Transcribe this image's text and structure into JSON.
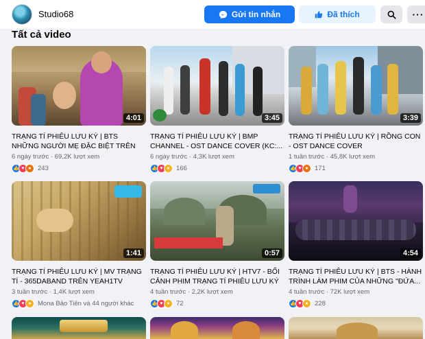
{
  "header": {
    "page_name": "Studio68",
    "send_message_label": "Gửi tin nhắn",
    "liked_label": "Đã thích",
    "more_label": "···"
  },
  "section": {
    "title": "Tất cả video"
  },
  "videos": [
    {
      "title": "TRẠNG TÍ PHIÊU LƯU KÝ | BTS NHỮNG NGƯỜI MẸ ĐẶC BIỆT TRÊN ĐOÀN PHI...",
      "duration": "4:01",
      "meta": "6 ngày trước · 69,2K lượt xem",
      "reaction_count": "243",
      "reactions": [
        "like",
        "love",
        "angry"
      ]
    },
    {
      "title": "TRẠNG TÍ PHIÊU LƯU KÝ | BMP CHANNEL - OST DANCE COVER (KC:...",
      "duration": "3:45",
      "meta": "6 ngày trước · 4,3K lượt xem",
      "reaction_count": "166",
      "reactions": [
        "like",
        "love",
        "haha"
      ]
    },
    {
      "title": "TRẠNG TÍ PHIÊU LƯU KÝ | RỒNG CON - OST DANCE COVER",
      "duration": "3:39",
      "meta": "1 tuần trước · 45,8K lượt xem",
      "reaction_count": "171",
      "reactions": [
        "like",
        "love",
        "angry"
      ]
    },
    {
      "title": "TRẠNG TÍ PHIÊU LƯU KÝ | MV TRẠNG TÍ - 365DABAND TRÊN YEAH1TV",
      "duration": "1:41",
      "meta": "3 tuần trước · 1,4K lượt xem",
      "reaction_count": "Mona Bảo Tiên và 44 người khác",
      "reactions": [
        "like",
        "love",
        "haha"
      ]
    },
    {
      "title": "TRẠNG TÍ PHIÊU LƯU KÝ | HTV7 - BỐI CẢNH PHIM TRẠNG TÍ PHIÊU LƯU KÝ",
      "duration": "0:57",
      "meta": "4 tuần trước · 2,2K lượt xem",
      "reaction_count": "72",
      "reactions": [
        "like",
        "love",
        "haha"
      ]
    },
    {
      "title": "TRẠNG TÍ PHIÊU LƯU KÝ | BTS - HÀNH TRÌNH LÀM PHIM CỦA NHỮNG \"ĐỨA...",
      "duration": "4:54",
      "meta": "4 tuần trước · 72K lượt xem",
      "reaction_count": "228",
      "reactions": [
        "like",
        "love",
        "haha"
      ]
    }
  ],
  "colors": {
    "accent": "#1877f2",
    "liked_bg": "#e7f3ff",
    "page_bg": "#f0f2f5"
  },
  "icons": {
    "messenger": "messenger-icon",
    "like": "thumbs-up-icon",
    "search": "search-icon",
    "more": "more-icon"
  }
}
